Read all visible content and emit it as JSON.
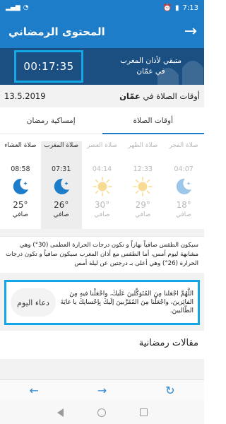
{
  "status_bar": {
    "time": "7:13",
    "battery": "▮"
  },
  "app_bar": {
    "title": "المحتوى الرمضاني",
    "back_icon": "arrow-right-icon"
  },
  "countdown": {
    "timer": "00:17:35",
    "label_line1": "متبقي لأذان المغرب",
    "label_line2": "في عمّان"
  },
  "location": {
    "date": "13.5.2019",
    "prefix": "أوقات الصلاة في",
    "city": "عمّان"
  },
  "tabs": [
    {
      "label": "أوقات الصلاة",
      "active": true
    },
    {
      "label": "إمساكية رمضان",
      "active": false
    }
  ],
  "prayers": [
    {
      "name": "صلاة الفجر",
      "time": "04:07",
      "icon": "moon-star-icon",
      "temp": "18°",
      "cond": "صافي",
      "state": "past"
    },
    {
      "name": "صلاة الظهر",
      "time": "12:33",
      "icon": "sun-icon",
      "temp": "29°",
      "cond": "صافي",
      "state": "past"
    },
    {
      "name": "صلاة العصر",
      "time": "04:14",
      "icon": "sun-icon",
      "temp": "30°",
      "cond": "صافي",
      "state": "past"
    },
    {
      "name": "صلاة المغرب",
      "time": "07:31",
      "icon": "moon-star-icon",
      "temp": "26°",
      "cond": "صافي",
      "state": "current"
    },
    {
      "name": "صلاة العشاء",
      "time": "08:58",
      "icon": "moon-star-icon",
      "temp": "25°",
      "cond": "صافي",
      "state": "upcoming"
    }
  ],
  "weather_note": "سيكون الطقس صافياً نهاراً و تكون درجات الحرارة العظمى (30°) وهي مشابهة ليوم أمس، أما الطقس مع أذان المغرب سيكون صافياً و تكون درجات الحرارة (26°) وهي أعلى بـ درجتين عن ليلة أمس",
  "dua": {
    "text": "اللَّهُمَّ اجْعَلنا مِنَ المُتَوَكِّلينَ عَلَيكَ، واجْعَلْنا فيهِ مِنَ الفائِزينَ، واجْعَلْنا مِنَ المُقَرَّبينَ إلَيكَ بِإحْسانِكَ يا غايَةَ الطّالبينَ.",
    "badge": "دعاء اليوم"
  },
  "articles": {
    "title": "مقالات رمضانية"
  },
  "browser_bar": {
    "back": "←",
    "forward": "→",
    "reload": "↻"
  },
  "colors": {
    "primary": "#1e7dc9",
    "banner": "#1b4f82",
    "highlight": "#14a7e6",
    "sun": "#f5c23d",
    "moon": "#1e7dc9"
  }
}
